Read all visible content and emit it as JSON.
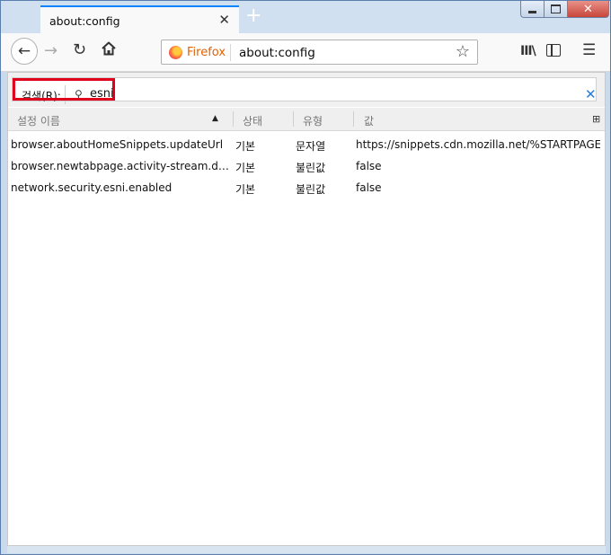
{
  "window": {
    "tab_title": "about:config",
    "new_tab_label": "+"
  },
  "navbar": {
    "identity_label": "Firefox",
    "url": "about:config"
  },
  "search": {
    "label": "검색(R):",
    "value": "esni"
  },
  "table": {
    "columns": [
      "설정 이름",
      "상태",
      "유형",
      "값"
    ],
    "sort_column": "설정 이름",
    "rows": [
      {
        "name": "browser.aboutHomeSnippets.updateUrl",
        "status": "기본",
        "type": "문자열",
        "value": "https://snippets.cdn.mozilla.net/%STARTPAGE_VE..."
      },
      {
        "name": "browser.newtabpage.activity-stream.disableS...",
        "status": "기본",
        "type": "불린값",
        "value": "false"
      },
      {
        "name": "network.security.esni.enabled",
        "status": "기본",
        "type": "불린값",
        "value": "false"
      }
    ]
  },
  "colors": {
    "tab_accent": "#0a84ff",
    "highlight_border": "#e0001b",
    "identity_text": "#e66000"
  }
}
